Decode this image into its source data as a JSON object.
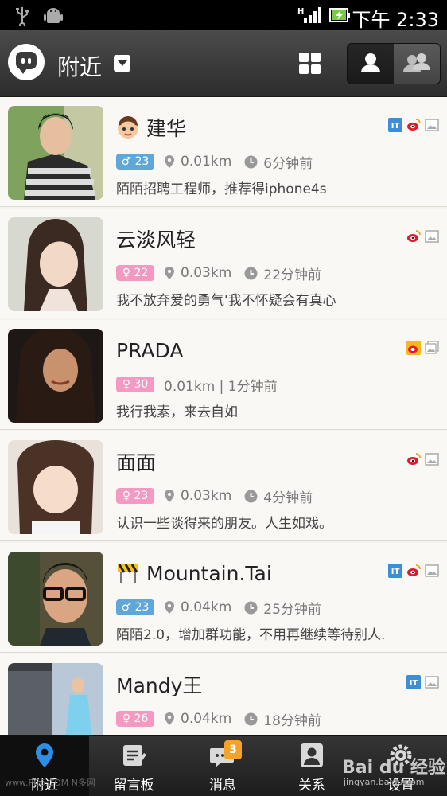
{
  "status_bar": {
    "time": "下午 2:33",
    "usb_icon": "usb-icon",
    "android_icon": "android-debug-icon"
  },
  "header": {
    "title": "附近",
    "logo_icon": "momo-logo-icon",
    "grid_icon": "grid-view-icon",
    "toggle": [
      "single-user-icon",
      "group-users-icon"
    ]
  },
  "users": [
    {
      "name": "建华",
      "emoji": "boy-face-icon",
      "gender": "male",
      "age": "23",
      "distance": "0.01km",
      "time": "6分钟前",
      "signature": "陌陌招聘工程师，推荐得iphone4s",
      "badges": [
        "it-icon",
        "weibo-icon",
        "photo-icon"
      ]
    },
    {
      "name": "云淡风轻",
      "gender": "female",
      "age": "22",
      "distance": "0.03km",
      "time": "22分钟前",
      "signature": "我不放弃爱的勇气'我不怀疑会有真心",
      "badges": [
        "weibo-icon",
        "photo-icon"
      ]
    },
    {
      "name": "PRADA",
      "gender": "female",
      "age": "30",
      "distance": "0.01km | 1分钟前",
      "time": "",
      "signature": "我行我素，来去自如",
      "badges": [
        "weibo-yellow-icon",
        "photo-stack-icon"
      ]
    },
    {
      "name": "面面",
      "gender": "female",
      "age": "23",
      "distance": "0.03km",
      "time": "4分钟前",
      "signature": "认识一些谈得来的朋友。人生如戏。",
      "badges": [
        "weibo-icon",
        "photo-icon"
      ]
    },
    {
      "name": "Mountain.Tai",
      "emoji": "construction-icon",
      "gender": "male",
      "age": "23",
      "distance": "0.04km",
      "time": "25分钟前",
      "signature": "陌陌2.0，增加群功能，不用再继续等待别人.",
      "badges": [
        "it-icon",
        "weibo-icon",
        "photo-icon"
      ]
    },
    {
      "name": "Mandy王",
      "gender": "female",
      "age": "26",
      "distance": "0.04km",
      "time": "18分钟前",
      "signature": "",
      "badges": [
        "it-icon",
        "photo-icon"
      ]
    }
  ],
  "nav": {
    "tabs": [
      {
        "label": "附近",
        "icon": "location-pin-icon"
      },
      {
        "label": "留言板",
        "icon": "message-board-icon"
      },
      {
        "label": "消息",
        "icon": "chat-bubble-icon",
        "badge": "3"
      },
      {
        "label": "关系",
        "icon": "contacts-icon"
      },
      {
        "label": "设置",
        "icon": "settings-icon"
      }
    ]
  },
  "watermark": {
    "left": "www.PC6.COM N多网",
    "brand": "Bai du 经验",
    "url": "jingyan.baidu.com"
  },
  "colors": {
    "male_badge": "#5fa7d9",
    "female_badge": "#f49ac2",
    "nav_badge": "#f4a32a",
    "active_pin": "#2d8ee6"
  }
}
